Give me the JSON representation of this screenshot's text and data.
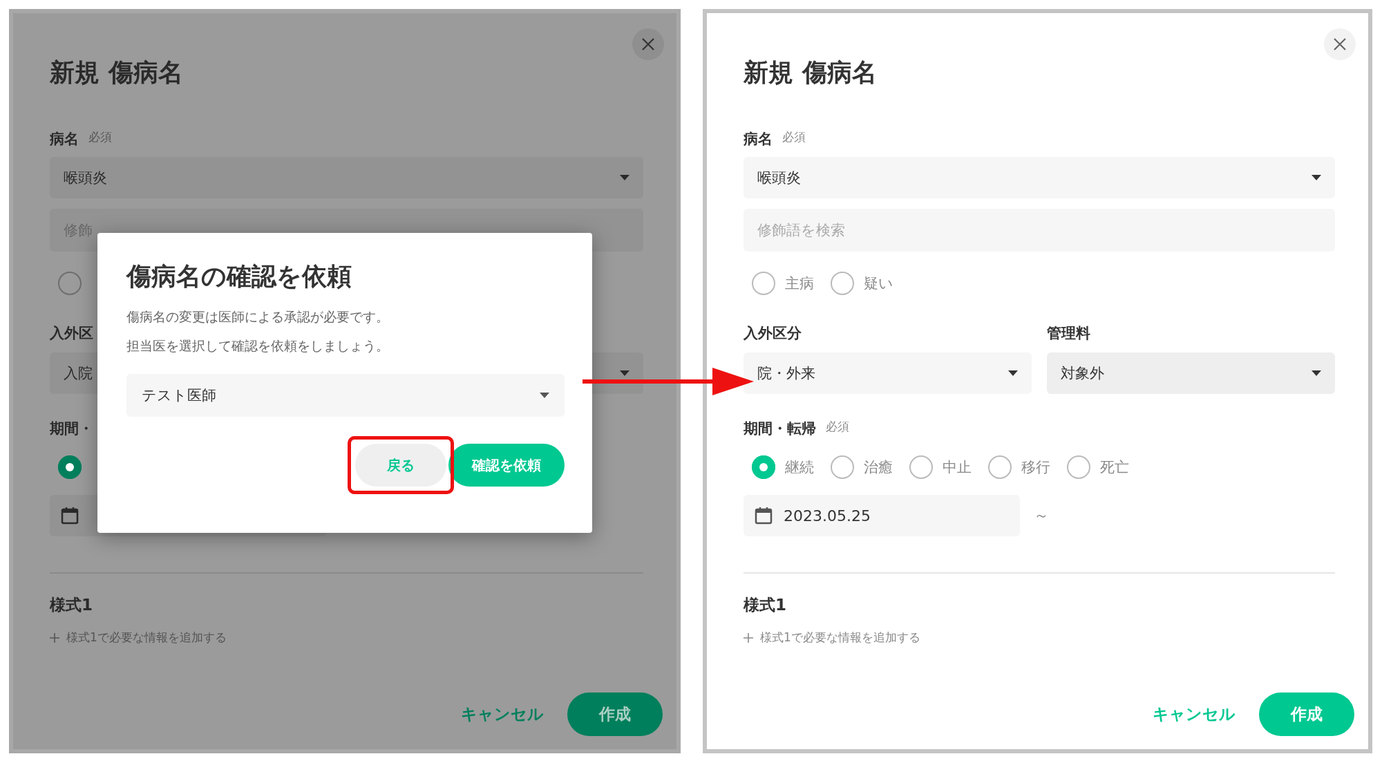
{
  "panels": [
    {
      "dimmed": true,
      "title": "新規 傷病名",
      "name_label": "病名",
      "name_required": "必須",
      "disease": "喉頭炎",
      "modifier_placeholder": "修飾",
      "type_radios": [
        {
          "selected": false
        }
      ],
      "category_label": "入外区",
      "category_value": "入院",
      "period_label": "期間・",
      "period_radios": [
        {
          "selected": true
        }
      ],
      "section_title": "様式1",
      "add_link": "様式1で必要な情報を追加する",
      "cancel": "キャンセル",
      "create": "作成",
      "dialog": {
        "title": "傷病名の確認を依頼",
        "message": [
          "傷病名の変更は医師による承認が必要です。",
          "担当医を選択して確認を依頼をしましょう。"
        ],
        "doctor": "テスト医師",
        "back": "戻る",
        "back_highlighted": true,
        "request": "確認を依頼"
      }
    },
    {
      "dimmed": false,
      "title": "新規 傷病名",
      "name_label": "病名",
      "name_required": "必須",
      "disease": "喉頭炎",
      "modifier_placeholder": "修飾語を検索",
      "type_radios": [
        {
          "label": "主病",
          "selected": false
        },
        {
          "label": "疑い",
          "selected": false
        }
      ],
      "category_label": "入外区分",
      "category_value": "院・外来",
      "fee_label": "管理料",
      "fee_value": "対象外",
      "period_label": "期間・転帰",
      "period_required": "必須",
      "period_radios": [
        {
          "label": "継続",
          "selected": true
        },
        {
          "label": "治癒",
          "selected": false
        },
        {
          "label": "中止",
          "selected": false
        },
        {
          "label": "移行",
          "selected": false
        },
        {
          "label": "死亡",
          "selected": false
        }
      ],
      "date_value": "2023.05.25",
      "tilde": "～",
      "section_title": "様式1",
      "add_link": "様式1で必要な情報を追加する",
      "cancel": "キャンセル",
      "create": "作成"
    }
  ]
}
